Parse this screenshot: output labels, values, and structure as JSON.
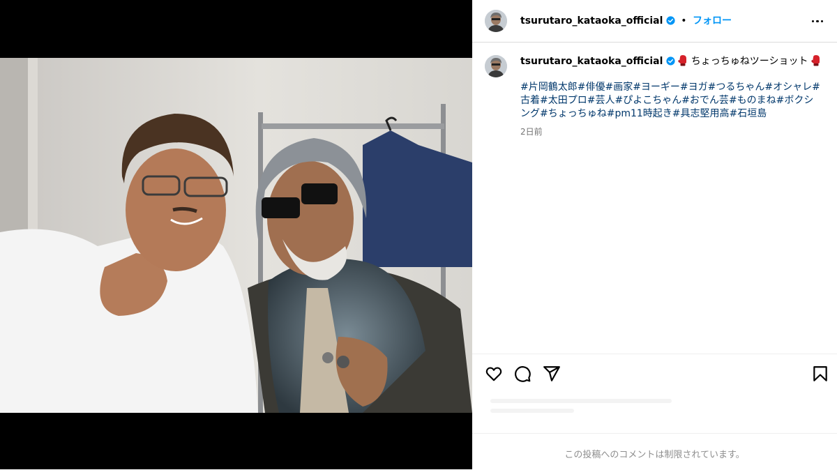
{
  "header": {
    "username": "tsurutaro_kataoka_official",
    "separator": "•",
    "follow_label": "フォロー",
    "more_icon": "more-horizontal-icon"
  },
  "post": {
    "username": "tsurutaro_kataoka_official",
    "caption_text": "ちょっちゅねツーショット",
    "hashtags": "#片岡鶴太郎#俳優#画家#ヨーギー#ヨガ#つるちゃん#オシャレ#古着#太田プロ#芸人#ぴよこちゃん#おでん芸#ものまね#ボクシング#ちょっちゅね#pm11時起き#具志堅用高#石垣島",
    "age": "2日前"
  },
  "actions": {
    "like_icon": "heart-icon",
    "comment_icon": "comment-icon",
    "share_icon": "send-icon",
    "save_icon": "bookmark-icon"
  },
  "footer": {
    "comments_limited": "この投稿へのコメントは制限されています。"
  },
  "colors": {
    "accent": "#0095f6",
    "hashtag": "#00376b",
    "muted": "#737373",
    "border": "#dbdbdb",
    "glove": "#d6212a"
  }
}
